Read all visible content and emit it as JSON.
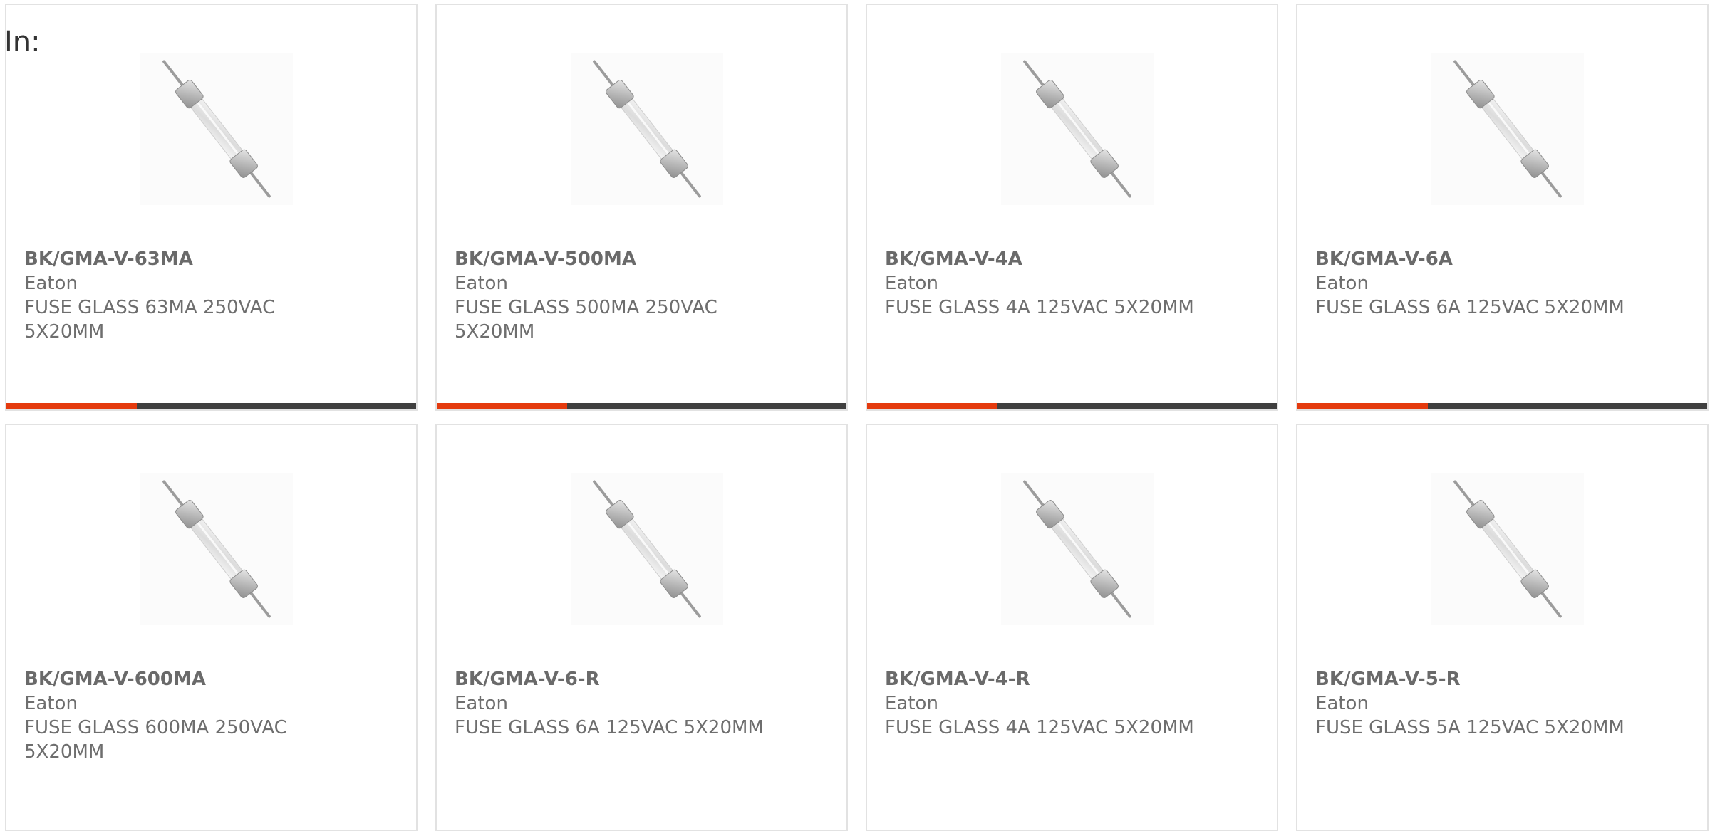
{
  "page": {
    "label": "In:"
  },
  "colors": {
    "accent": "#e43a0e",
    "bar": "#3f3f3f",
    "text": "#6e6e6e",
    "border": "#e2e2e2"
  },
  "products": [
    {
      "part_number": "BK/GMA-V-63MA",
      "manufacturer": "Eaton",
      "description": "FUSE GLASS 63MA 250VAC 5X20MM",
      "image_icon": "glass-fuse-icon",
      "show_bar": true
    },
    {
      "part_number": "BK/GMA-V-500MA",
      "manufacturer": "Eaton",
      "description": "FUSE GLASS 500MA 250VAC 5X20MM",
      "image_icon": "glass-fuse-icon",
      "show_bar": true
    },
    {
      "part_number": "BK/GMA-V-4A",
      "manufacturer": "Eaton",
      "description": "FUSE GLASS 4A 125VAC 5X20MM",
      "image_icon": "glass-fuse-icon",
      "show_bar": true
    },
    {
      "part_number": "BK/GMA-V-6A",
      "manufacturer": "Eaton",
      "description": "FUSE GLASS 6A 125VAC 5X20MM",
      "image_icon": "glass-fuse-icon",
      "show_bar": true
    },
    {
      "part_number": "BK/GMA-V-600MA",
      "manufacturer": "Eaton",
      "description": "FUSE GLASS 600MA 250VAC 5X20MM",
      "image_icon": "glass-fuse-icon",
      "show_bar": false
    },
    {
      "part_number": "BK/GMA-V-6-R",
      "manufacturer": "Eaton",
      "description": "FUSE GLASS 6A 125VAC 5X20MM",
      "image_icon": "glass-fuse-icon",
      "show_bar": false
    },
    {
      "part_number": "BK/GMA-V-4-R",
      "manufacturer": "Eaton",
      "description": "FUSE GLASS 4A 125VAC 5X20MM",
      "image_icon": "glass-fuse-icon",
      "show_bar": false
    },
    {
      "part_number": "BK/GMA-V-5-R",
      "manufacturer": "Eaton",
      "description": "FUSE GLASS 5A 125VAC 5X20MM",
      "image_icon": "glass-fuse-icon",
      "show_bar": false
    }
  ]
}
